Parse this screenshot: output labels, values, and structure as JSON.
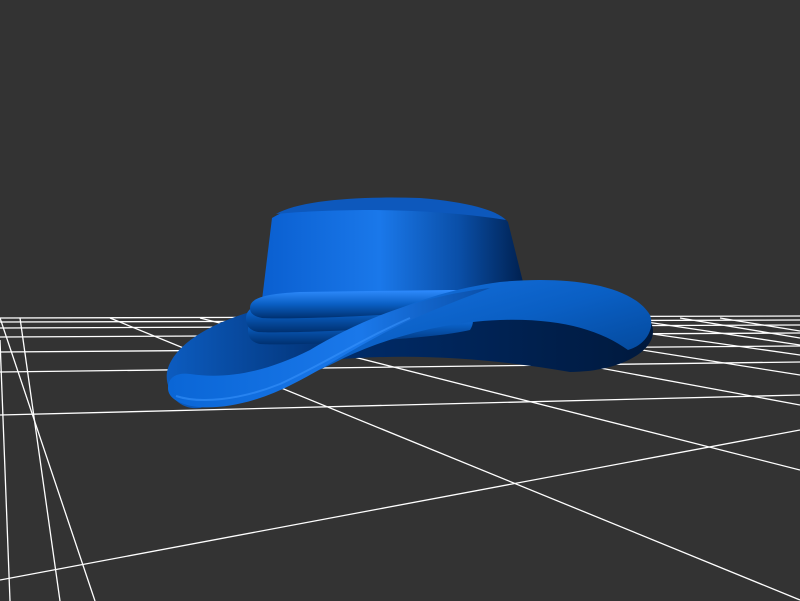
{
  "scene": {
    "background_color": "#333333",
    "grid_color": "#ffffff",
    "model": {
      "name": "hat",
      "color": "#0a66d6",
      "shadow_color": "#002a66",
      "highlight_color": "#2f8cff"
    }
  }
}
